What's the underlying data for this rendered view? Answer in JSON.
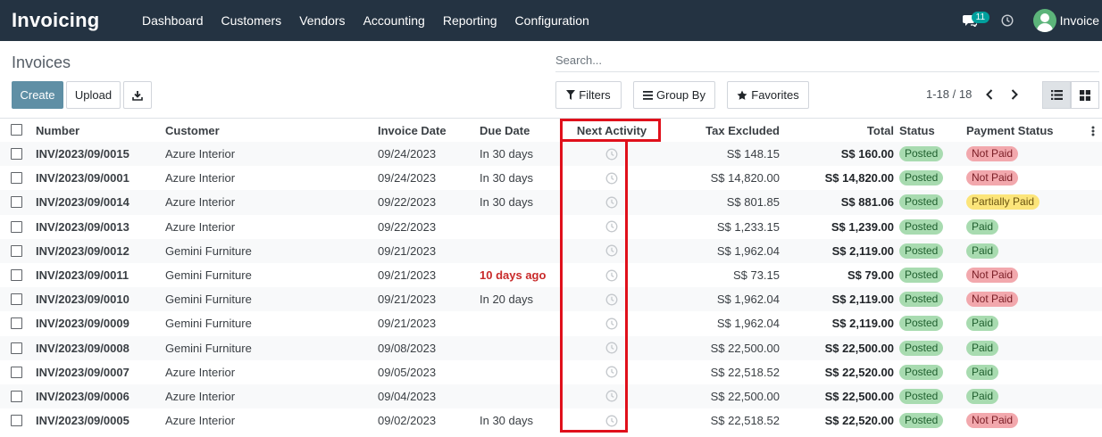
{
  "navbar": {
    "app_title": "Invoicing",
    "menu": [
      "Dashboard",
      "Customers",
      "Vendors",
      "Accounting",
      "Reporting",
      "Configuration"
    ],
    "messages_count": "11",
    "user_name": "Invoice",
    "background_color": "#243342"
  },
  "control_panel": {
    "breadcrumb": "Invoices",
    "search_placeholder": "Search...",
    "create_label": "Create",
    "upload_label": "Upload",
    "filters_label": "Filters",
    "group_by_label": "Group By",
    "favorites_label": "Favorites",
    "pager": "1-18 / 18",
    "accent_color": "#5f8fa5"
  },
  "table": {
    "headers": {
      "number": "Number",
      "customer": "Customer",
      "invoice_date": "Invoice Date",
      "due_date": "Due Date",
      "next_activity": "Next Activity",
      "tax_excluded": "Tax Excluded",
      "total": "Total",
      "status": "Status",
      "payment_status": "Payment Status"
    },
    "rows": [
      {
        "number": "INV/2023/09/0015",
        "customer": "Azure Interior",
        "invoice_date": "09/24/2023",
        "due_date": "In 30 days",
        "overdue": false,
        "tax_excluded": "S$ 148.15",
        "total": "S$ 160.00",
        "status": "Posted",
        "payment_status": "Not Paid",
        "pay_kind": "notpaid"
      },
      {
        "number": "INV/2023/09/0001",
        "customer": "Azure Interior",
        "invoice_date": "09/24/2023",
        "due_date": "In 30 days",
        "overdue": false,
        "tax_excluded": "S$ 14,820.00",
        "total": "S$ 14,820.00",
        "status": "Posted",
        "payment_status": "Not Paid",
        "pay_kind": "notpaid"
      },
      {
        "number": "INV/2023/09/0014",
        "customer": "Azure Interior",
        "invoice_date": "09/22/2023",
        "due_date": "In 30 days",
        "overdue": false,
        "tax_excluded": "S$ 801.85",
        "total": "S$ 881.06",
        "status": "Posted",
        "payment_status": "Partially Paid",
        "pay_kind": "partial"
      },
      {
        "number": "INV/2023/09/0013",
        "customer": "Azure Interior",
        "invoice_date": "09/22/2023",
        "due_date": "",
        "overdue": false,
        "tax_excluded": "S$ 1,233.15",
        "total": "S$ 1,239.00",
        "status": "Posted",
        "payment_status": "Paid",
        "pay_kind": "paid"
      },
      {
        "number": "INV/2023/09/0012",
        "customer": "Gemini Furniture",
        "invoice_date": "09/21/2023",
        "due_date": "",
        "overdue": false,
        "tax_excluded": "S$ 1,962.04",
        "total": "S$ 2,119.00",
        "status": "Posted",
        "payment_status": "Paid",
        "pay_kind": "paid"
      },
      {
        "number": "INV/2023/09/0011",
        "customer": "Gemini Furniture",
        "invoice_date": "09/21/2023",
        "due_date": "10 days ago",
        "overdue": true,
        "tax_excluded": "S$ 73.15",
        "total": "S$ 79.00",
        "status": "Posted",
        "payment_status": "Not Paid",
        "pay_kind": "notpaid"
      },
      {
        "number": "INV/2023/09/0010",
        "customer": "Gemini Furniture",
        "invoice_date": "09/21/2023",
        "due_date": "In 20 days",
        "overdue": false,
        "tax_excluded": "S$ 1,962.04",
        "total": "S$ 2,119.00",
        "status": "Posted",
        "payment_status": "Not Paid",
        "pay_kind": "notpaid"
      },
      {
        "number": "INV/2023/09/0009",
        "customer": "Gemini Furniture",
        "invoice_date": "09/21/2023",
        "due_date": "",
        "overdue": false,
        "tax_excluded": "S$ 1,962.04",
        "total": "S$ 2,119.00",
        "status": "Posted",
        "payment_status": "Paid",
        "pay_kind": "paid"
      },
      {
        "number": "INV/2023/09/0008",
        "customer": "Gemini Furniture",
        "invoice_date": "09/08/2023",
        "due_date": "",
        "overdue": false,
        "tax_excluded": "S$ 22,500.00",
        "total": "S$ 22,500.00",
        "status": "Posted",
        "payment_status": "Paid",
        "pay_kind": "paid"
      },
      {
        "number": "INV/2023/09/0007",
        "customer": "Azure Interior",
        "invoice_date": "09/05/2023",
        "due_date": "",
        "overdue": false,
        "tax_excluded": "S$ 22,518.52",
        "total": "S$ 22,520.00",
        "status": "Posted",
        "payment_status": "Paid",
        "pay_kind": "paid"
      },
      {
        "number": "INV/2023/09/0006",
        "customer": "Azure Interior",
        "invoice_date": "09/04/2023",
        "due_date": "",
        "overdue": false,
        "tax_excluded": "S$ 22,500.00",
        "total": "S$ 22,500.00",
        "status": "Posted",
        "payment_status": "Paid",
        "pay_kind": "paid"
      },
      {
        "number": "INV/2023/09/0005",
        "customer": "Azure Interior",
        "invoice_date": "09/02/2023",
        "due_date": "In 30 days",
        "overdue": false,
        "tax_excluded": "S$ 22,518.52",
        "total": "S$ 22,520.00",
        "status": "Posted",
        "payment_status": "Not Paid",
        "pay_kind": "notpaid"
      }
    ]
  },
  "annotation": {
    "highlight_color": "#e0101b",
    "highlighted_column": "Next Activity"
  }
}
